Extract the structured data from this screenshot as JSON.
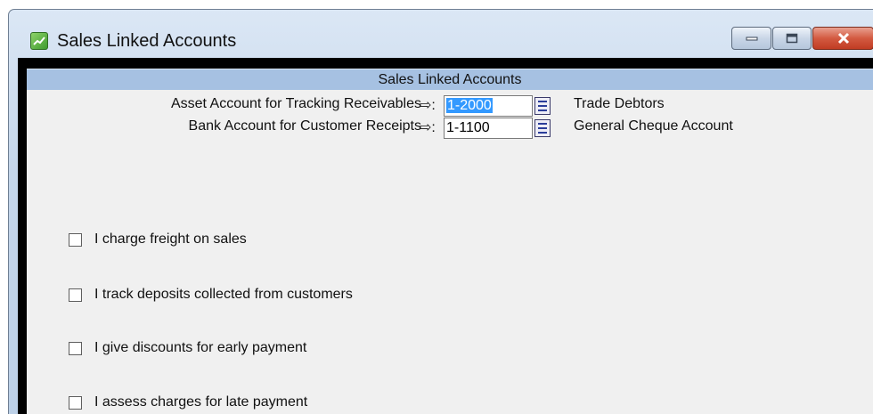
{
  "window": {
    "title": "Sales Linked Accounts"
  },
  "header": {
    "title": "Sales Linked Accounts"
  },
  "accounts": [
    {
      "label": "Asset Account for Tracking Receivables",
      "arrow": "⇨:",
      "value": "1-2000",
      "name": "Trade Debtors"
    },
    {
      "label": "Bank Account for Customer Receipts",
      "arrow": "⇨:",
      "value": "1-1100",
      "name": "General Cheque Account"
    }
  ],
  "options": [
    {
      "label": "I charge freight on sales",
      "checked": false
    },
    {
      "label": "I track deposits collected from customers",
      "checked": false
    },
    {
      "label": "I give discounts for early payment",
      "checked": false
    },
    {
      "label": "I assess charges for late payment",
      "checked": false
    }
  ]
}
